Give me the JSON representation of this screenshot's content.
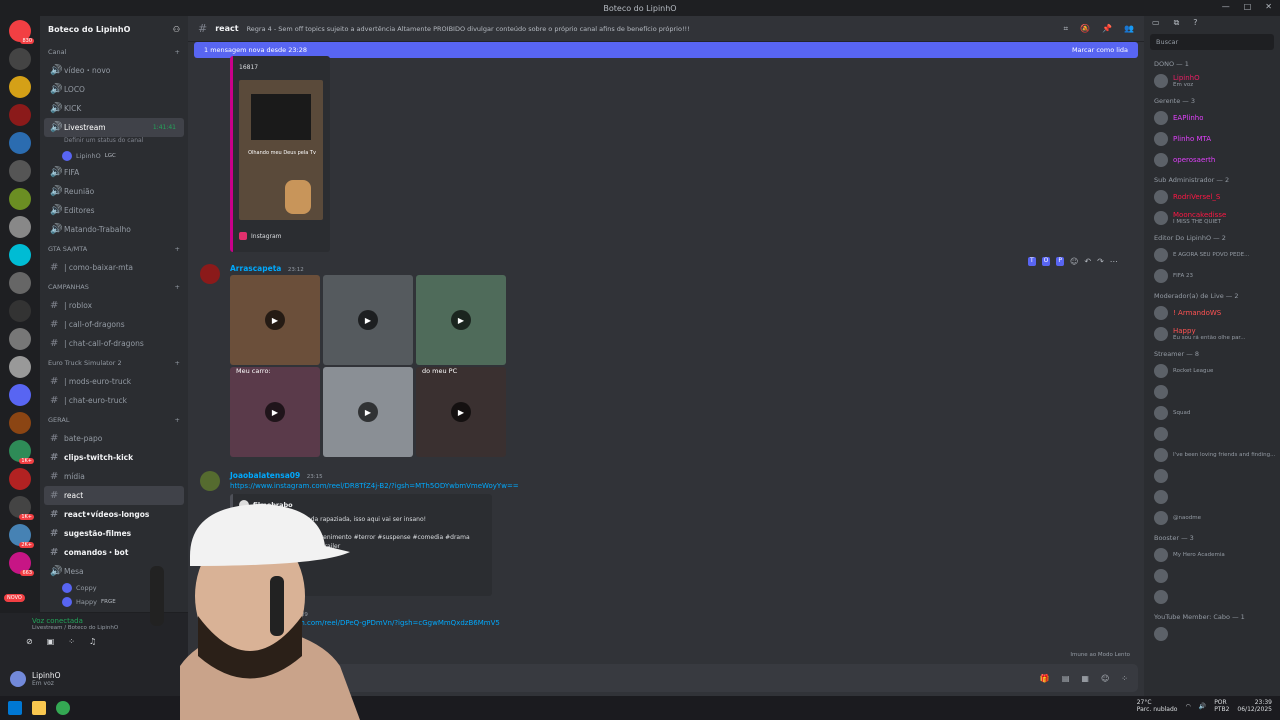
{
  "window": {
    "title": "Boteco do LipinhO"
  },
  "guilds": [
    {
      "badge": "830",
      "color": "#f23f43"
    },
    {
      "badge": "",
      "color": "#444"
    },
    {
      "badge": "",
      "color": "#d4a017"
    },
    {
      "badge": "",
      "color": "#8b1a1a"
    },
    {
      "badge": "",
      "color": "#2b6cb0"
    },
    {
      "badge": "",
      "color": "#555"
    },
    {
      "badge": "",
      "color": "#6b8e23"
    },
    {
      "badge": "",
      "color": "#888"
    },
    {
      "badge": "",
      "color": "#00bcd4"
    },
    {
      "badge": "",
      "color": "#666"
    },
    {
      "badge": "",
      "color": "#333"
    },
    {
      "badge": "",
      "color": "#777"
    },
    {
      "badge": "",
      "color": "#999"
    },
    {
      "badge": "",
      "color": "#5865f2"
    },
    {
      "badge": "",
      "color": "#8b4513"
    },
    {
      "badge": "1K+",
      "color": "#2e8b57"
    },
    {
      "badge": "",
      "color": "#b22222"
    },
    {
      "badge": "1K+",
      "color": "#444"
    },
    {
      "badge": "2K+",
      "color": "#4682b4"
    },
    {
      "badge": "663",
      "color": "#c71585"
    }
  ],
  "sidebar": {
    "server_name": "Boteco do LipinhO",
    "items": [
      {
        "type": "cat",
        "label": "Canal"
      },
      {
        "type": "voice",
        "label": "vídeo・novo"
      },
      {
        "type": "voice",
        "label": "LOCO"
      },
      {
        "type": "voice",
        "label": "KICK"
      },
      {
        "type": "voice-active",
        "label": "Livestream",
        "extra": "1:41:41"
      },
      {
        "type": "sub",
        "label": "Definir um status do canal"
      },
      {
        "type": "vuser",
        "label": "LipinhO",
        "extra": "LGC"
      },
      {
        "type": "voice",
        "label": "FIFA"
      },
      {
        "type": "voice",
        "label": "Reunião"
      },
      {
        "type": "voice",
        "label": "Editores"
      },
      {
        "type": "voice",
        "label": "Matando-Trabalho"
      },
      {
        "type": "cat",
        "label": "GTA SA/MTA"
      },
      {
        "type": "text",
        "label": "| como-baixar-mta"
      },
      {
        "type": "cat",
        "label": "CAMPANHAS"
      },
      {
        "type": "text",
        "label": "| roblox"
      },
      {
        "type": "text",
        "label": "| call-of-dragons"
      },
      {
        "type": "text",
        "label": "| chat-call-of-dragons"
      },
      {
        "type": "cat",
        "label": "Euro Truck Simulator 2"
      },
      {
        "type": "text",
        "label": "| mods-euro-truck"
      },
      {
        "type": "text",
        "label": "| chat-euro-truck"
      },
      {
        "type": "cat",
        "label": "GERAL"
      },
      {
        "type": "text",
        "label": "bate-papo"
      },
      {
        "type": "text-bold",
        "label": "clips-twitch-kick"
      },
      {
        "type": "text",
        "label": "mídia"
      },
      {
        "type": "text-active",
        "label": "react"
      },
      {
        "type": "text-bold",
        "label": "react•vídeos-longos"
      },
      {
        "type": "text-bold",
        "label": "sugestão-filmes"
      },
      {
        "type": "text-bold",
        "label": "comandos・bot"
      },
      {
        "type": "voice",
        "label": "Mesa"
      },
      {
        "type": "vuser",
        "label": "Coppy",
        "extra": ""
      },
      {
        "type": "vuser",
        "label": "Happy",
        "extra": "FRGE"
      }
    ]
  },
  "voice": {
    "status": "Voz conectada",
    "channel": "Livestream / Boteco do LipinhO",
    "novo_badge": "NOVO"
  },
  "user": {
    "name": "LipinhO",
    "status": "Em voz"
  },
  "header": {
    "channel": "react",
    "topic": "Regra 4 - Sem off topics sujeito a advertência Altamente PROIBIDO divulgar conteúdo sobre o próprio canal afins de benefício próprio!!!"
  },
  "newbar": {
    "text": "1 mensagem nova desde 23:28",
    "action": "Marcar como lida"
  },
  "messages": {
    "embed1": {
      "top_text": "16817",
      "caption": "Olhando meu Deus pela Tv",
      "source": "Instagram"
    },
    "msg2": {
      "author": "Arrascapeta",
      "time": "23:12",
      "captions": [
        "",
        "",
        "",
        "Meu carro:",
        "",
        "do meu PC"
      ]
    },
    "msg3": {
      "author": "Joaobalatensa09",
      "time": "23:15",
      "link": "https://www.instagram.com/reel/DR8TfZ4j-B2/?igsh=MTh5ODYwbmVmeWoyYw==",
      "embed_author": "filmebrabo",
      "embed_line1": "É a última temporada rapaziada, isso aqui vai ser insano!",
      "embed_line2": "nema #cultura #entretenimento #terror #suspense #comedia #drama",
      "embed_line3": "es #cenas #theboys #trailer"
    },
    "msg4": {
      "time": "23:09",
      "link": "w.instagram.com/reel/DPeQ-gPDmVn/?igsh=cGgwMmQxdzB6MmV5",
      "footer": "languadalty"
    }
  },
  "slowmode": "Imune ao Modo Lento",
  "members": {
    "search_placeholder": "Buscar",
    "groups": [
      {
        "label": "DONO — 1",
        "members": [
          {
            "name": "LipinhO",
            "status": "Em voz",
            "color": "#e91e63"
          }
        ]
      },
      {
        "label": "Gerente — 3",
        "members": [
          {
            "name": "EAPlinho",
            "status": "",
            "color": "#e040fb"
          },
          {
            "name": "Plinho MTA",
            "status": "",
            "color": "#e040fb"
          },
          {
            "name": "operosaerth",
            "status": "",
            "color": "#e040fb"
          }
        ]
      },
      {
        "label": "Sub Administrador — 2",
        "members": [
          {
            "name": "RodriVersel_S",
            "status": "",
            "color": "#ff1744"
          },
          {
            "name": "Mooncakedisse",
            "status": "I MISS THE QUIET",
            "color": "#ff1744"
          }
        ]
      },
      {
        "label": "Editor Do LipinhO — 2",
        "members": [
          {
            "name": "",
            "status": "E AGORA SEU POVO PEDE...",
            "color": "#ff4081"
          },
          {
            "name": "",
            "status": "FIFA 23",
            "color": "#ff4081"
          }
        ]
      },
      {
        "label": "Moderador(a) de Live — 2",
        "members": [
          {
            "name": "! ArmandoWS",
            "status": "",
            "color": "#ff5252"
          },
          {
            "name": "Happy",
            "status": "Eu sou rá então olhe par...",
            "color": "#ff5252"
          }
        ]
      },
      {
        "label": "Streamer — 8",
        "members": [
          {
            "name": "",
            "status": "Rocket League",
            "color": "#7c4dff"
          },
          {
            "name": "",
            "status": "",
            "color": "#7c4dff"
          },
          {
            "name": "",
            "status": "Squad",
            "color": "#7c4dff"
          },
          {
            "name": "",
            "status": "",
            "color": "#7c4dff"
          },
          {
            "name": "",
            "status": "I've been loving friends and finding...",
            "color": "#7c4dff"
          },
          {
            "name": "",
            "status": "",
            "color": "#7c4dff"
          },
          {
            "name": "",
            "status": "",
            "color": "#7c4dff"
          },
          {
            "name": "",
            "status": "@naodme",
            "color": "#7c4dff"
          }
        ]
      },
      {
        "label": "Booster — 3",
        "members": [
          {
            "name": "",
            "status": "My Hero Academia",
            "color": "#d500f9"
          },
          {
            "name": "",
            "status": "",
            "color": "#d500f9"
          },
          {
            "name": "",
            "status": "",
            "color": "#d500f9"
          }
        ]
      },
      {
        "label": "YouTube Member: Cabo — 1",
        "members": [
          {
            "name": "",
            "status": "",
            "color": "#ff1744"
          }
        ]
      }
    ]
  },
  "taskbar": {
    "weather_temp": "27°C",
    "weather_desc": "Parc. nublado",
    "lang": "POR",
    "layout": "PTB2",
    "time": "23:39",
    "date": "06/12/2025"
  }
}
